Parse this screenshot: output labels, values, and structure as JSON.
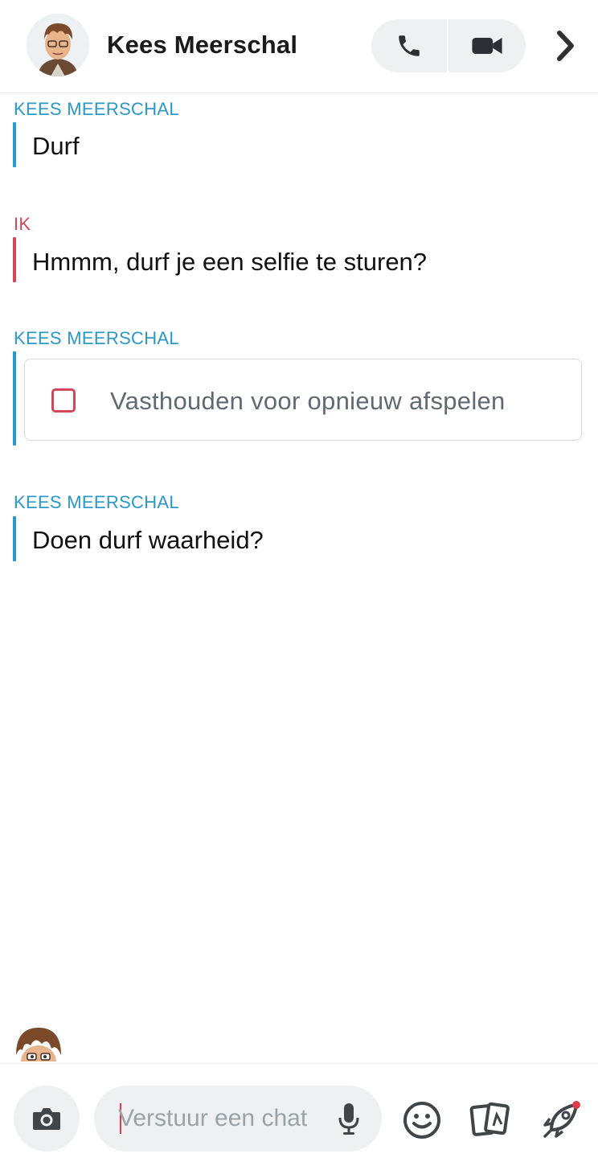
{
  "header": {
    "contact_name": "Kees Meerschal",
    "icons": {
      "avatar": "bitmoji-avatar",
      "call": "phone-icon",
      "video": "video-camera-icon",
      "more": "chevron-right-icon"
    }
  },
  "messages": [
    {
      "sender": "KEES MEERSCHAL",
      "text": "Durf",
      "side": "them"
    },
    {
      "sender": "IK",
      "text": "Hmmm, durf je een selfie te sturen?",
      "side": "me"
    },
    {
      "sender": "KEES MEERSCHAL",
      "snap_label": "Vasthouden voor opnieuw afspelen",
      "side": "them"
    },
    {
      "sender": "KEES MEERSCHAL",
      "text": "Doen durf waarheid?",
      "side": "them"
    }
  ],
  "composer": {
    "placeholder": "Verstuur een chat",
    "icons": [
      "camera-icon",
      "microphone-icon",
      "emoji-icon",
      "stickers-icon",
      "rocket-icon"
    ]
  },
  "colors": {
    "them": "#2a98c8",
    "me": "#d2475a",
    "grey_ui": "#eef0f2"
  }
}
